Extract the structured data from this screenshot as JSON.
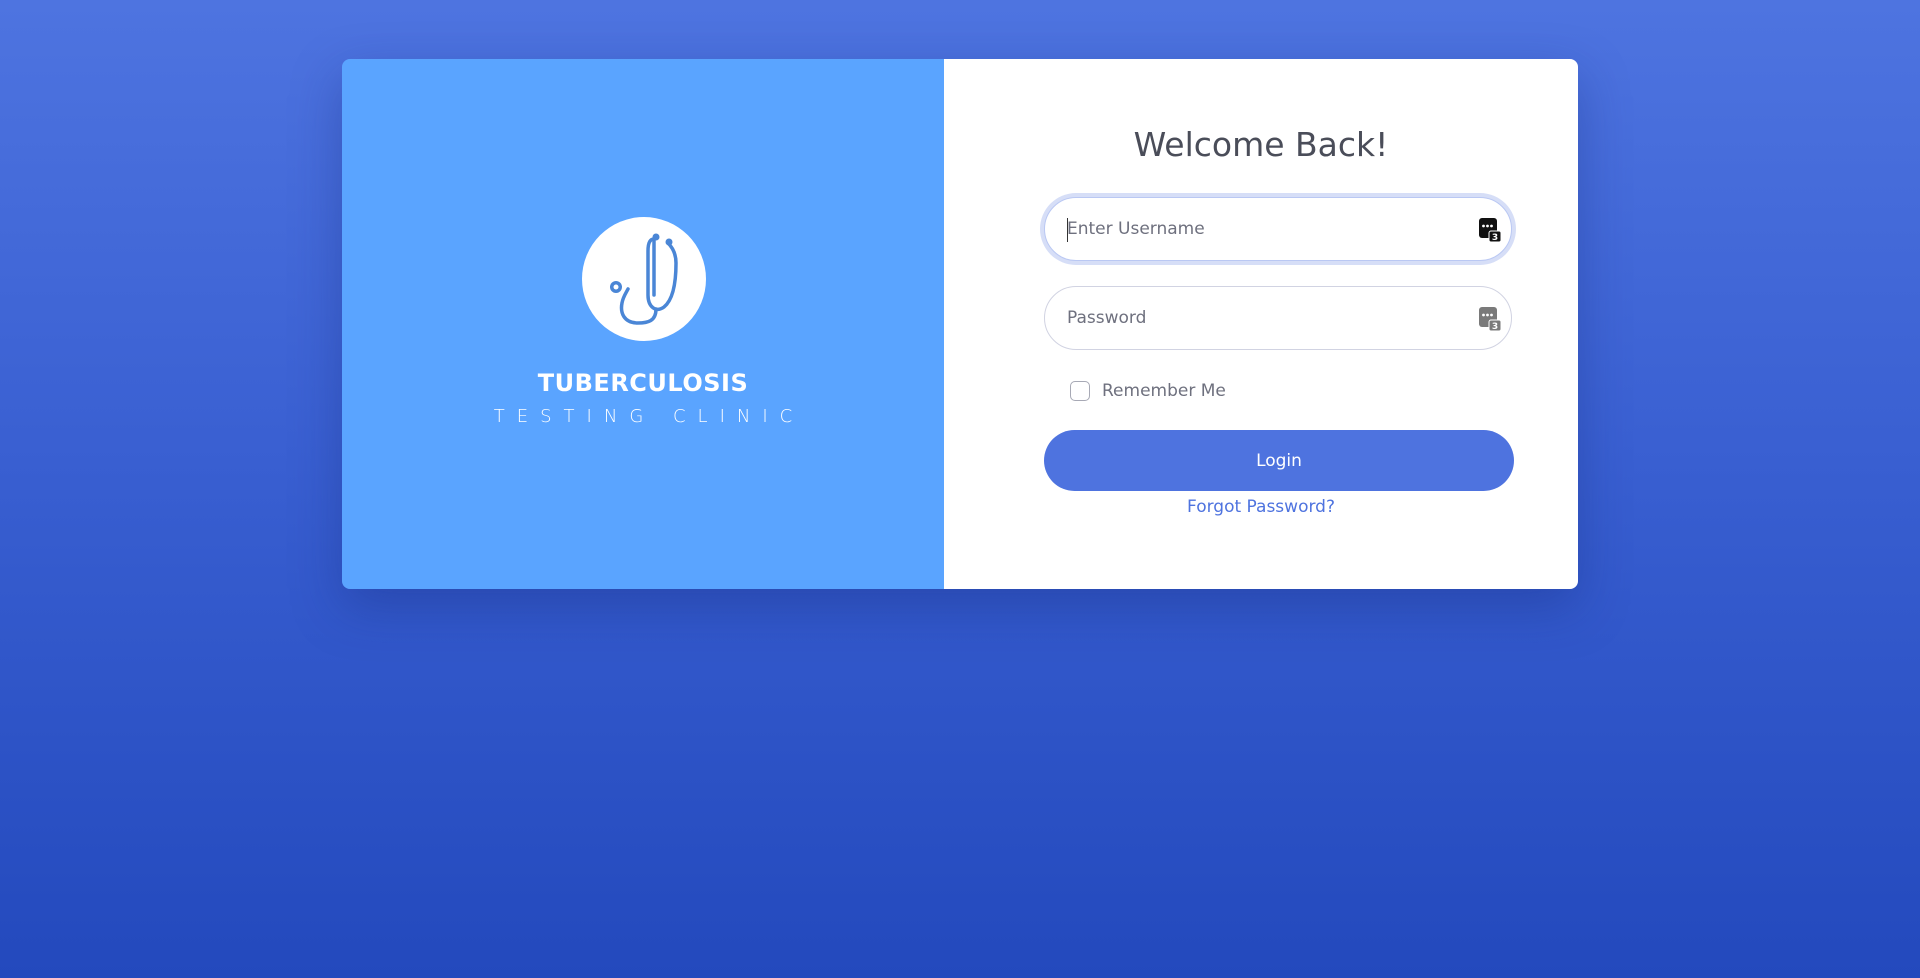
{
  "brand": {
    "title": "TUBERCULOSIS",
    "subtitle": "TESTING CLINIC",
    "logo_icon": "stethoscope-icon",
    "panel_color": "#5aa4ff"
  },
  "login_form": {
    "heading": "Welcome Back!",
    "username": {
      "placeholder": "Enter Username",
      "value": ""
    },
    "password": {
      "placeholder": "Password",
      "value": ""
    },
    "remember_me": {
      "label": "Remember Me",
      "checked": false
    },
    "login_button": "Login",
    "forgot_password": "Forgot Password?",
    "accent_color": "#4e73df"
  }
}
